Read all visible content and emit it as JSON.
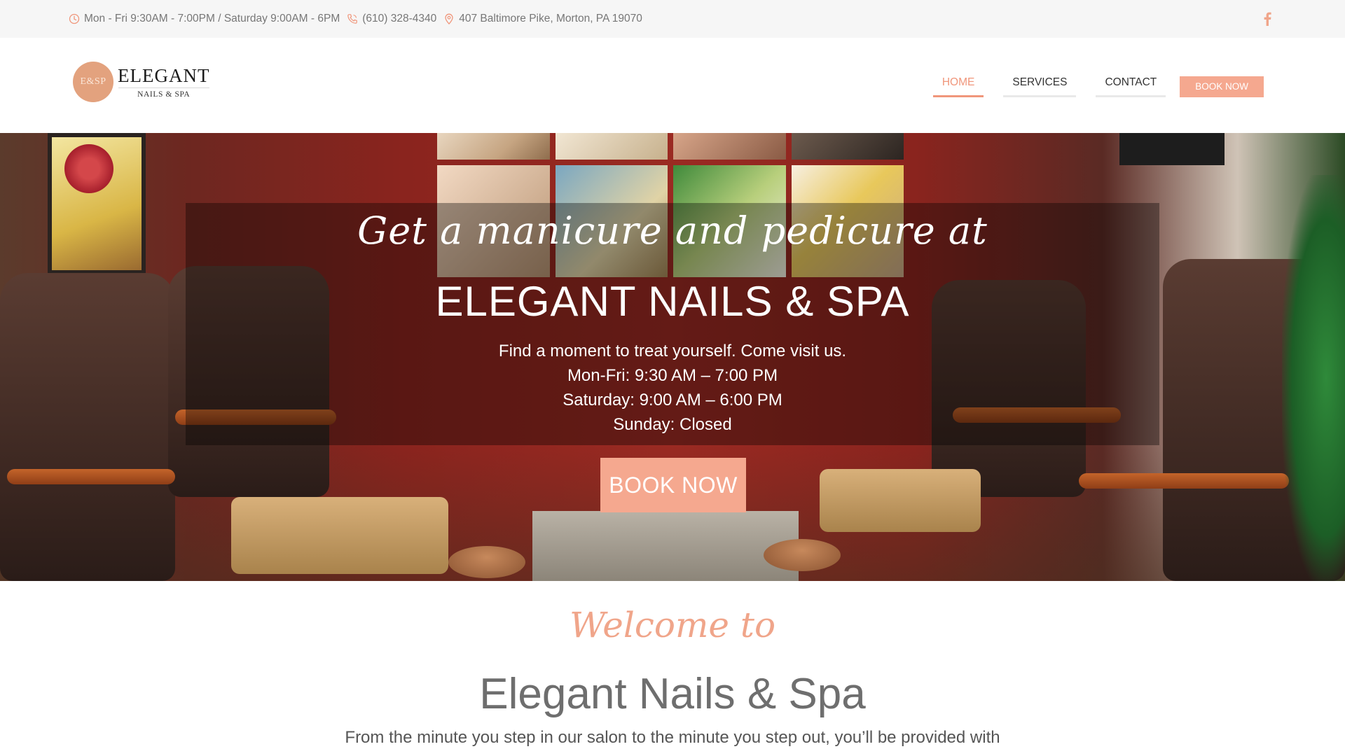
{
  "topbar": {
    "hours": "Mon - Fri 9:30AM - 7:00PM / Saturday 9:00AM - 6PM",
    "phone": "(610) 328-4340",
    "address": "407 Baltimore Pike, Morton, PA 19070",
    "social_icon": "facebook-icon",
    "accent": "#f0967b"
  },
  "logo": {
    "badge": "E&SP",
    "name": "ELEGANT",
    "tagline": "NAILS & SPA"
  },
  "nav": {
    "items": [
      {
        "label": "HOME",
        "active": true
      },
      {
        "label": "SERVICES",
        "active": false
      },
      {
        "label": "CONTACT",
        "active": false
      }
    ],
    "book_label": "BOOK NOW"
  },
  "hero": {
    "script": "Get a manicure and pedicure at",
    "title": "ELEGANT NAILS & SPA",
    "lines": [
      "Find a moment to treat yourself. Come visit us.",
      "Mon-Fri: 9:30 AM – 7:00 PM",
      "Saturday: 9:00 AM – 6:00 PM",
      "Sunday: Closed"
    ],
    "book_label": "BOOK NOW"
  },
  "welcome": {
    "script": "Welcome to",
    "title": "Elegant Nails & Spa",
    "text": "From the minute you step in our salon to the minute you step out, you’ll be provided with"
  },
  "colors": {
    "accent": "#f5a88f",
    "topbar_bg": "#f6f6f6"
  }
}
